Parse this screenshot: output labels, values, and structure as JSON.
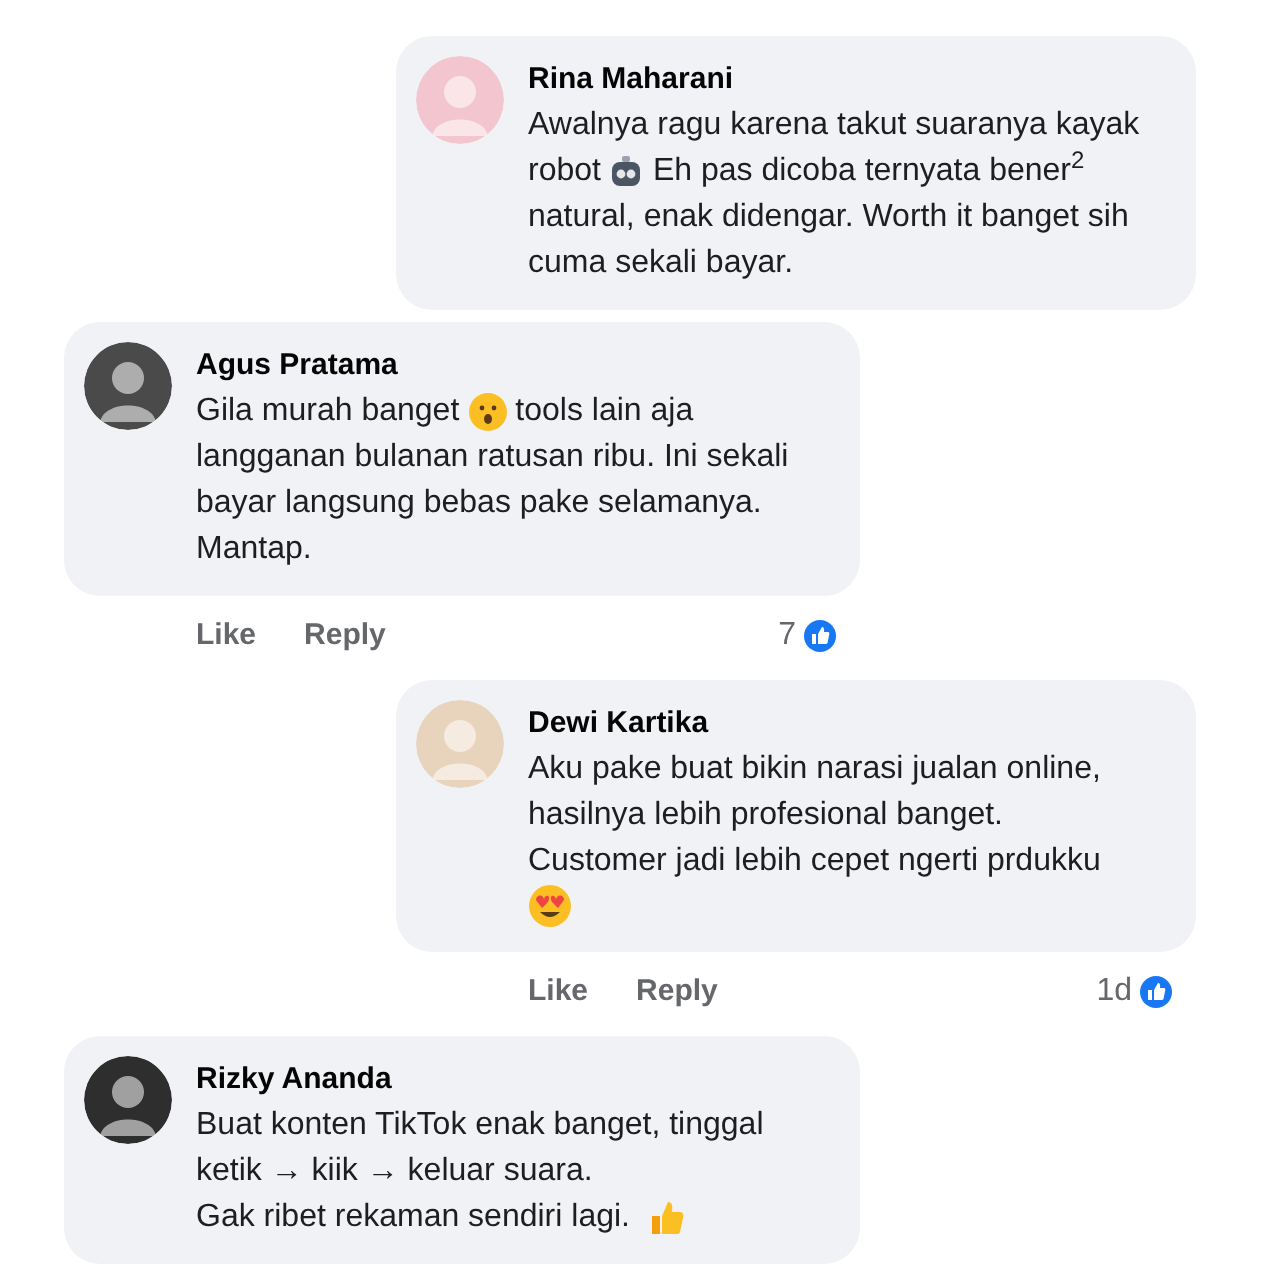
{
  "comments": [
    {
      "kind": "indented",
      "name": "Rina Maharani",
      "color": "#f3c6cf",
      "lines": [
        [
          {
            "kind": "text",
            "text": "Awalnya ragu karena takut suaranya kayak"
          }
        ],
        [
          {
            "kind": "text",
            "text": "robot"
          },
          {
            "kind": "robot"
          },
          {
            "kind": "text",
            "text": "Eh pas dicoba ternyata bener$^{2}$"
          }
        ],
        [
          {
            "kind": "text",
            "text": "natural, enak didengar. Worth it banget sih"
          }
        ],
        [
          {
            "kind": "text",
            "text": "cuma sekali bayar."
          }
        ]
      ]
    },
    {
      "kind": "flush",
      "name": "Agus Pratama",
      "color": "#4a4a4a",
      "lines": [
        [
          {
            "kind": "text",
            "text": "Gila murah banget"
          },
          {
            "kind": "surprised"
          },
          {
            "kind": "text",
            "text": "tools lain aja"
          }
        ],
        [
          {
            "kind": "text",
            "text": "langganan bulanan ratusan ribu. Ini sekali"
          }
        ],
        [
          {
            "kind": "text",
            "text": "bayar langsung bebas pake selamanya."
          }
        ],
        [
          {
            "kind": "text",
            "text": "Mantap."
          }
        ]
      ],
      "footer": {
        "like": "Like",
        "reply": "Reply",
        "meta": "7"
      }
    },
    {
      "kind": "indented",
      "name": "Dewi Kartika",
      "color": "#e8d3bd",
      "lines": [
        [
          {
            "kind": "text",
            "text": "Aku pake buat bikin narasi jualan online,"
          }
        ],
        [
          {
            "kind": "text",
            "text": "hasilnya lebih profesional banget."
          }
        ],
        [
          {
            "kind": "text",
            "text": "Customer jadi lebih cepet ngerti prdukku"
          }
        ],
        [
          {
            "kind": "heart-eyes"
          }
        ]
      ],
      "footer": {
        "like": "Like",
        "reply": "Reply",
        "meta": "1d"
      }
    },
    {
      "kind": "flush",
      "name": "Rizky Ananda",
      "color": "#2e2e2e",
      "lines": [
        [
          {
            "kind": "text",
            "text": "Buat konten TikTok enak banget, tinggal"
          }
        ],
        [
          {
            "kind": "text",
            "text": "ketik → kiik → keluar suara."
          }
        ],
        [
          {
            "kind": "text",
            "text": "Gak ribet rekaman sendiri lagi."
          },
          {
            "kind": "thumbs-up"
          }
        ]
      ]
    }
  ]
}
